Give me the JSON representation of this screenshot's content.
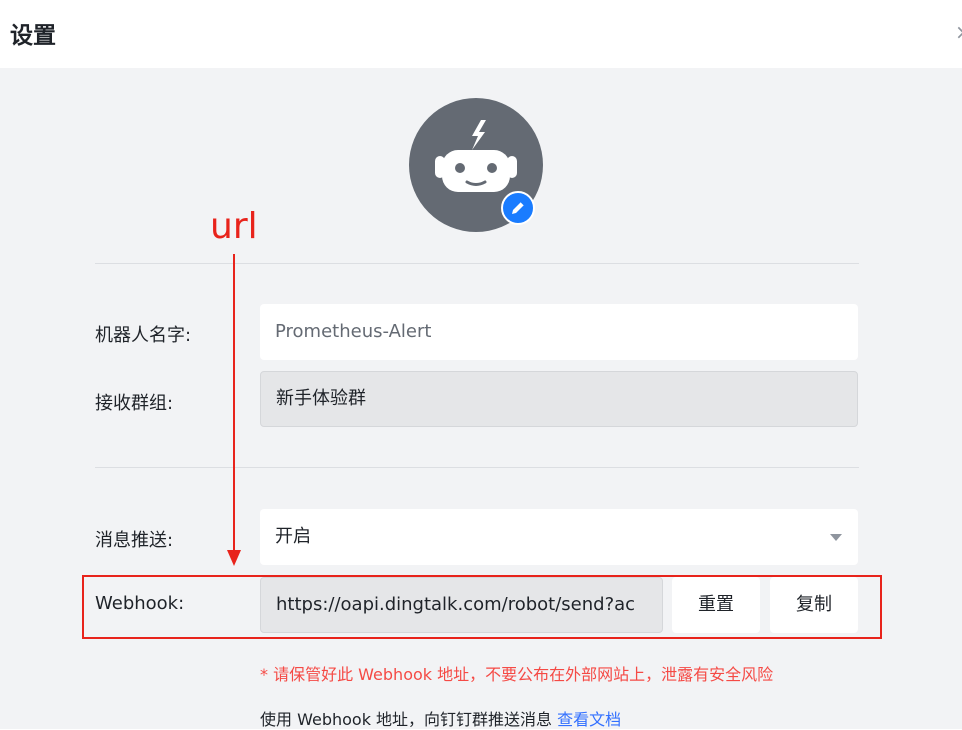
{
  "dialog": {
    "title": "设置",
    "close_glyph": "×"
  },
  "avatar": {
    "icon": "robot-icon",
    "edit_icon": "pencil-icon"
  },
  "form": {
    "robot_name": {
      "label": "机器人名字:",
      "placeholder": "Prometheus-Alert"
    },
    "group": {
      "label": "接收群组:",
      "value": "新手体验群"
    },
    "push": {
      "label": "消息推送:",
      "value": "开启"
    },
    "webhook": {
      "label": "Webhook:",
      "value": "https://oapi.dingtalk.com/robot/send?ac",
      "reset_label": "重置",
      "copy_label": "复制"
    }
  },
  "notice": {
    "warning": "* 请保管好此 Webhook 地址，不要公布在外部网站上，泄露有安全风险",
    "usage": "使用 Webhook 地址，向钉钉群推送消息",
    "doc_link": "查看文档"
  },
  "annotation": {
    "text": "url",
    "color": "#e8231b"
  }
}
